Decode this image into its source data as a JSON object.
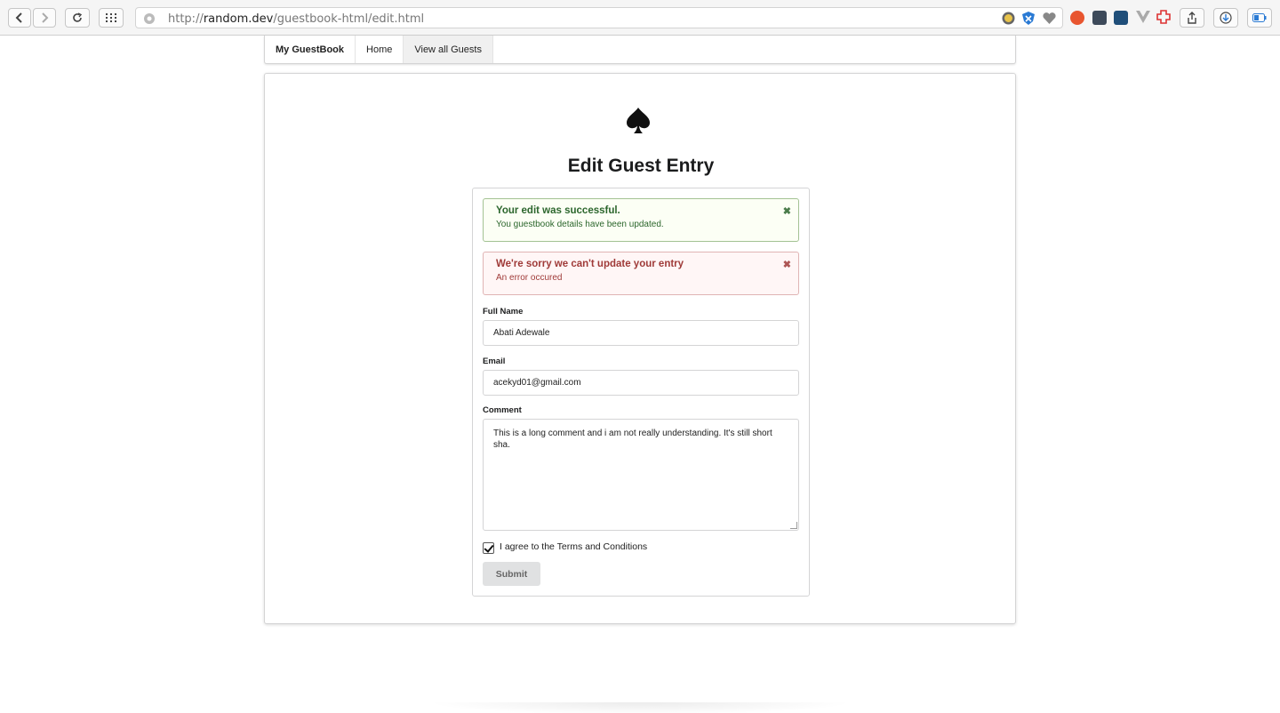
{
  "browser": {
    "url_prefix": "http://",
    "url_host": "random.dev",
    "url_path": "/guestbook-html/edit.html"
  },
  "nav": {
    "brand": "My GuestBook",
    "items": [
      "Home",
      "View all Guests"
    ]
  },
  "page": {
    "title": "Edit Guest Entry",
    "logo_icon": "spade-icon"
  },
  "messages": {
    "success": {
      "header": "Your edit was successful.",
      "body": "You guestbook details have been updated.",
      "color": "#2c662d"
    },
    "error": {
      "header": "We're sorry we can't update your entry",
      "body": "An error occured",
      "color": "#9f3a38"
    },
    "close_glyph": "✖"
  },
  "form": {
    "full_name_label": "Full Name",
    "full_name_value": "Abati Adewale",
    "email_label": "Email",
    "email_value": "acekyd01@gmail.com",
    "comment_label": "Comment",
    "comment_value": "This is a long comment and i am not really understanding. It's still short sha.",
    "terms_label": "I agree to the Terms and Conditions",
    "terms_checked": true,
    "submit_label": "Submit"
  }
}
